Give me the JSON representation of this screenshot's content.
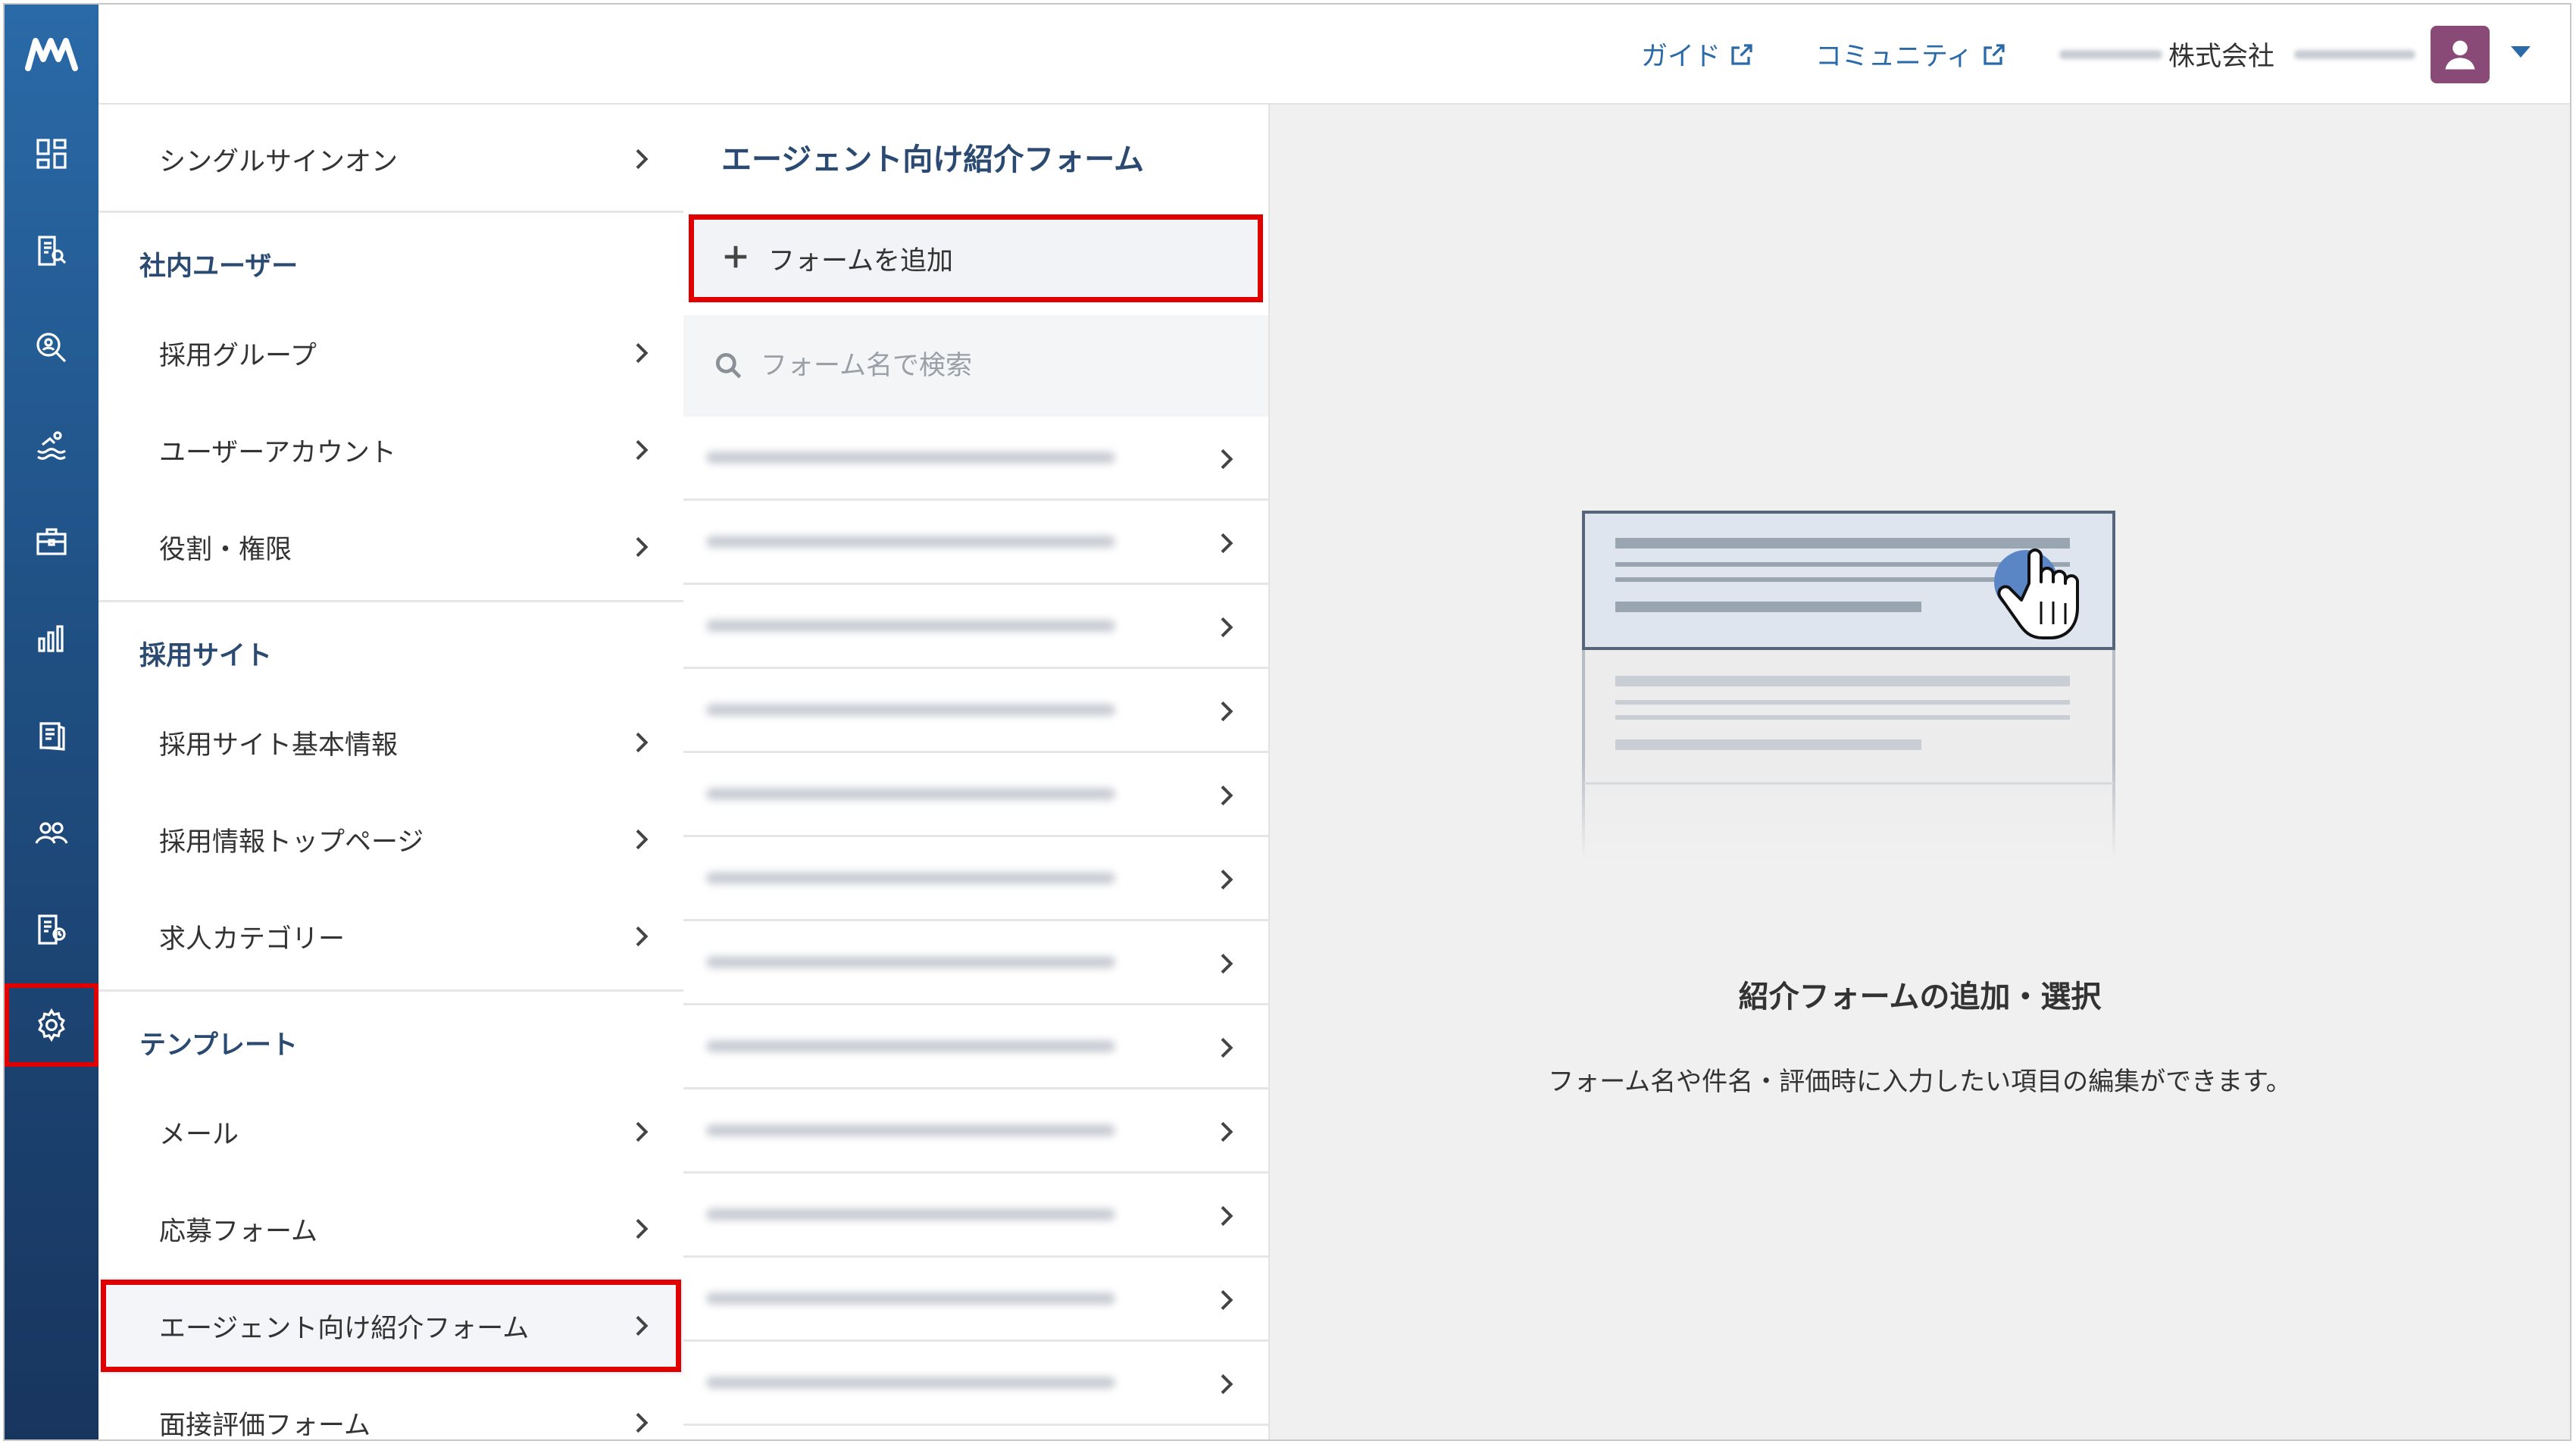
{
  "brand": {
    "logo_text": "M"
  },
  "header": {
    "guide_label": "ガイド",
    "community_label": "コミュニティ",
    "company_label": "株式会社"
  },
  "rail": {
    "items": [
      "dashboard-icon",
      "document-search-icon",
      "candidate-search-icon",
      "pool-icon",
      "briefcase-icon",
      "chart-icon",
      "book-icon",
      "people-icon",
      "document-settings-icon",
      "gear-icon"
    ],
    "selected": "gear-icon"
  },
  "menu": {
    "sso_label": "シングルサインオン",
    "section_users": "社内ユーザー",
    "hiring_group": "採用グループ",
    "user_account": "ユーザーアカウント",
    "roles": "役割・権限",
    "section_site": "採用サイト",
    "site_basic": "採用サイト基本情報",
    "site_top": "採用情報トップページ",
    "job_category": "求人カテゴリー",
    "section_template": "テンプレート",
    "mail": "メール",
    "application_form": "応募フォーム",
    "agent_form": "エージェント向け紹介フォーム",
    "interview_form": "面接評価フォーム"
  },
  "forms": {
    "title": "エージェント向け紹介フォーム",
    "add_label": "フォームを追加",
    "search_placeholder": "フォーム名で検索"
  },
  "empty_state": {
    "title": "紹介フォームの追加・選択",
    "description": "フォーム名や件名・評価時に入力したい項目の編集ができます。"
  },
  "colors": {
    "accent": "#2a6aa8",
    "highlight": "#e00000",
    "section_text": "#2b4a72"
  }
}
